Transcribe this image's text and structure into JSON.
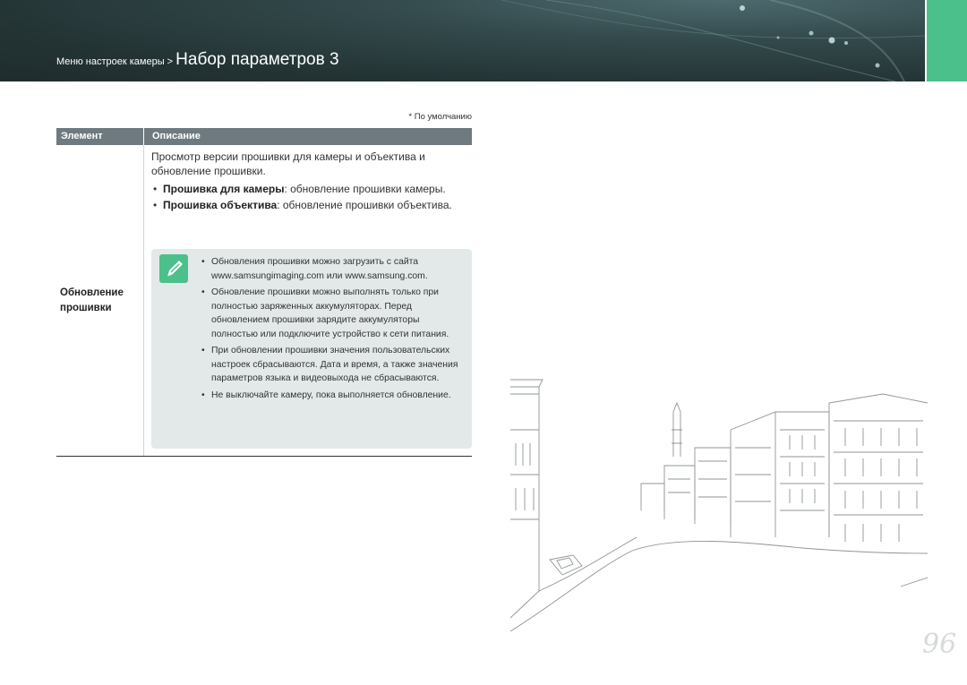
{
  "header": {
    "breadcrumb_parent": "Меню настроек камеры",
    "breadcrumb_sep": " > ",
    "breadcrumb_current": "Набор параметров 3"
  },
  "table": {
    "default_note": "* По умолчанию",
    "col_element": "Элемент",
    "col_description": "Описание",
    "row": {
      "element_line1": "Обновление",
      "element_line2": "прошивки",
      "intro": "Просмотр версии прошивки для камеры и объектива и обновление прошивки.",
      "bullets": [
        {
          "term": "Прошивка для камеры",
          "text": ": обновление прошивки камеры."
        },
        {
          "term": "Прошивка объектива",
          "text": ": обновление прошивки объектива."
        }
      ],
      "notes": [
        "Обновления прошивки можно загрузить с сайта www.samsungimaging.com или www.samsung.com.",
        "Обновление прошивки можно выполнять только при полностью заряженных аккумуляторах. Перед обновлением прошивки зарядите аккумуляторы полностью или подключите устройство к сети питания.",
        "При обновлении прошивки значения пользовательских настроек сбрасываются. Дата и время, а также значения параметров языка и видеовыхода не сбрасываются.",
        "Не выключайте камеру, пока выполняется обновление."
      ]
    }
  },
  "icons": {
    "note": "pencil-note-icon"
  },
  "colors": {
    "accent_green": "#4cc08a",
    "table_header": "#6e7a7f",
    "note_background": "#e3e8e9"
  },
  "page_number": "96"
}
